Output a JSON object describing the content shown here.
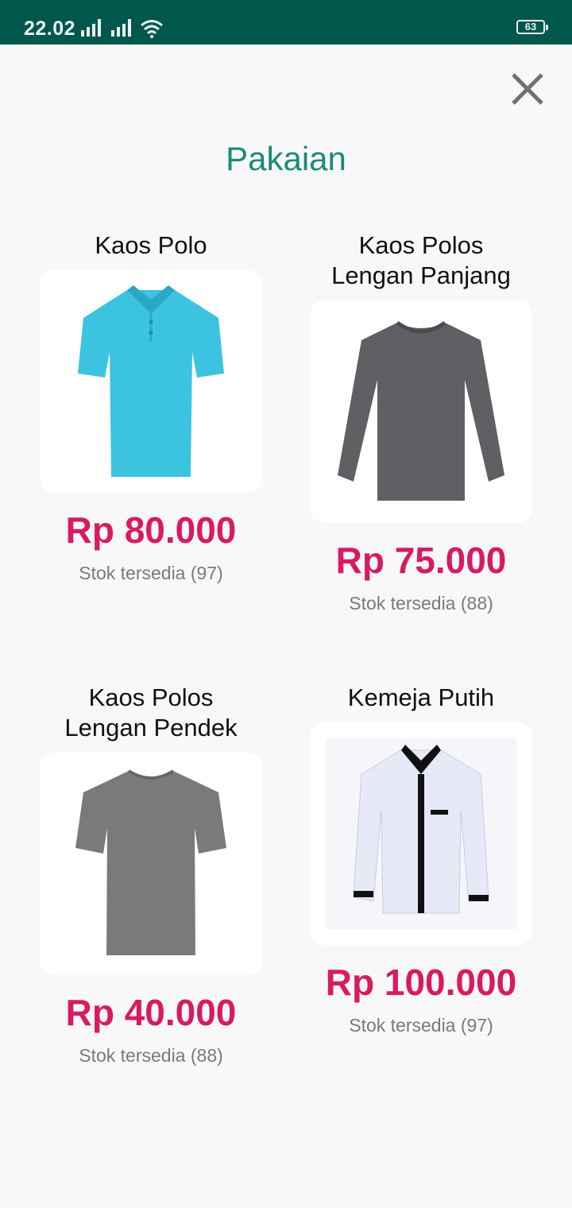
{
  "status_bar": {
    "time": "22.02",
    "battery": "63"
  },
  "page": {
    "title": "Pakaian"
  },
  "products": [
    {
      "name_line1": "Kaos Polo",
      "name_line2": "",
      "price": "Rp 80.000",
      "stock": "Stok tersedia (97)"
    },
    {
      "name_line1": "Kaos Polos",
      "name_line2": "Lengan Panjang",
      "price": "Rp 75.000",
      "stock": "Stok tersedia (88)"
    },
    {
      "name_line1": "Kaos Polos",
      "name_line2": "Lengan Pendek",
      "price": "Rp 40.000",
      "stock": "Stok tersedia (88)"
    },
    {
      "name_line1": "Kemeja Putih",
      "name_line2": "",
      "price": "Rp 100.000",
      "stock": "Stok tersedia (97)"
    }
  ],
  "icons": [
    "signal-icon",
    "wifi-icon",
    "battery-icon",
    "close-icon"
  ],
  "colors": {
    "status_bar": "#00574b",
    "title": "#1b8a78",
    "price": "#d81b60"
  }
}
